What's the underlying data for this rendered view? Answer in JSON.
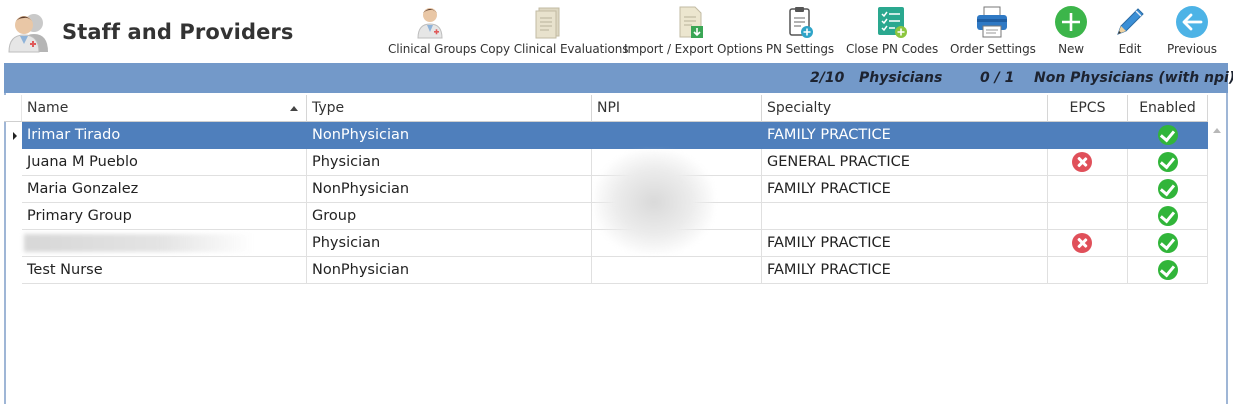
{
  "app": {
    "title": "Staff and Providers"
  },
  "toolbar": [
    {
      "id": "clinical-groups",
      "label": "Clinical Groups",
      "icon": "clinical-groups-icon"
    },
    {
      "id": "copy-clinical-evaluations",
      "label": "Copy Clinical Evaluations",
      "icon": "document-copy-icon"
    },
    {
      "id": "import-export-options",
      "label": "Import / Export Options",
      "icon": "import-export-icon"
    },
    {
      "id": "pn-settings",
      "label": "PN Settings",
      "icon": "clipboard-settings-icon"
    },
    {
      "id": "close-pn-codes",
      "label": "Close PN Codes",
      "icon": "checklist-icon"
    },
    {
      "id": "order-settings",
      "label": "Order Settings",
      "icon": "printer-icon"
    },
    {
      "id": "new",
      "label": "New",
      "icon": "plus-circle-icon"
    },
    {
      "id": "edit",
      "label": "Edit",
      "icon": "pencil-icon"
    },
    {
      "id": "previous",
      "label": "Previous",
      "icon": "arrow-left-circle-icon"
    }
  ],
  "summary": {
    "physicians_count": "2/10",
    "physicians_label": "Physicians",
    "non_physicians_count": "0 / 1",
    "non_physicians_label": "Non Physicians (with npi)"
  },
  "grid": {
    "columns": [
      "Name",
      "Type",
      "NPI",
      "Specialty",
      "EPCS",
      "Enabled"
    ],
    "rows": [
      {
        "name": "Irimar Tirado",
        "type": "NonPhysician",
        "npi": "",
        "specialty": "FAMILY PRACTICE",
        "epcs": "none",
        "enabled": "yes"
      },
      {
        "name": "Juana M Pueblo",
        "type": "Physician",
        "npi": "",
        "specialty": "GENERAL PRACTICE",
        "epcs": "no",
        "enabled": "yes"
      },
      {
        "name": "Maria Gonzalez",
        "type": "NonPhysician",
        "npi": "",
        "specialty": "FAMILY PRACTICE",
        "epcs": "none",
        "enabled": "yes"
      },
      {
        "name": "Primary Group",
        "type": "Group",
        "npi": "",
        "specialty": "",
        "epcs": "none",
        "enabled": "yes"
      },
      {
        "name": "",
        "type": "Physician",
        "npi": "",
        "specialty": "FAMILY PRACTICE",
        "epcs": "no",
        "enabled": "yes"
      },
      {
        "name": "Test Nurse",
        "type": "NonPhysician",
        "npi": "",
        "specialty": "FAMILY PRACTICE",
        "epcs": "none",
        "enabled": "yes"
      }
    ],
    "selected_row": 0
  },
  "colors": {
    "summary_bar": "#7399c9",
    "selected_row": "#4f7fbc",
    "ok_status": "#31b53a",
    "error_status": "#e0505a"
  }
}
